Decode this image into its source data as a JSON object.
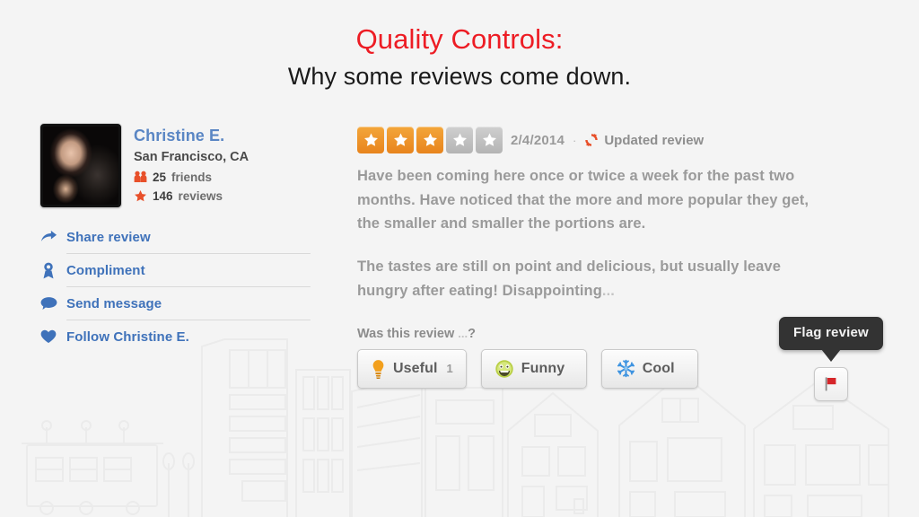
{
  "slide": {
    "background_color": "#f4f4f4",
    "title": "Quality Controls:",
    "title_color": "#ed1c24",
    "subtitle": "Why some reviews come down.",
    "subtitle_color": "#1a1a1a"
  },
  "user": {
    "name": "Christine E.",
    "name_color": "#5a86c4",
    "location": "San Francisco, CA",
    "friends_count": "25",
    "friends_label": "friends",
    "reviews_count": "146",
    "reviews_label": "reviews",
    "friends_icon": "friends-icon",
    "reviews_icon": "star-icon",
    "avatar_icon": "user-avatar-photo",
    "actions": [
      {
        "label": "Share review",
        "icon": "share-arrow-icon"
      },
      {
        "label": "Compliment",
        "icon": "ribbon-award-icon"
      },
      {
        "label": "Send message",
        "icon": "speech-bubble-icon"
      },
      {
        "label": "Follow Christine E.",
        "icon": "heart-icon"
      }
    ],
    "link_color": "#3f72ba"
  },
  "review": {
    "rating": 3,
    "rating_max": 5,
    "star_on_color": "#e8841d",
    "star_off_color": "#bdbdbd",
    "date": "2/4/2014",
    "separator": "·",
    "updated_icon": "refresh-circular-arrows-icon",
    "updated_label": "Updated review",
    "updated_icon_color": "#e8502a",
    "paragraph_1": "Have been coming here once or twice a week for the past two months. Have noticed that the more and more popular they get, the smaller and smaller the portions are.",
    "paragraph_2": "The tastes are still on point and delicious, but usually leave hungry after eating! Disappointing",
    "paragraph_2_ellipsis": "...",
    "feedback_prompt": "Was this review",
    "feedback_prompt_ellipsis": "...",
    "feedback_prompt_end": "?",
    "votes": [
      {
        "label": "Useful",
        "count": "1",
        "icon": "lightbulb-icon",
        "icon_color": "#f2a01e"
      },
      {
        "label": "Funny",
        "count": "",
        "icon": "smiley-face-icon",
        "icon_color": "#a9c22e"
      },
      {
        "label": "Cool",
        "count": "",
        "icon": "snowflake-icon",
        "icon_color": "#3d93e0"
      }
    ]
  },
  "flag": {
    "tooltip_label": "Flag review",
    "tooltip_bg": "#333333",
    "icon": "red-flag-icon",
    "icon_color": "#d6262a"
  }
}
